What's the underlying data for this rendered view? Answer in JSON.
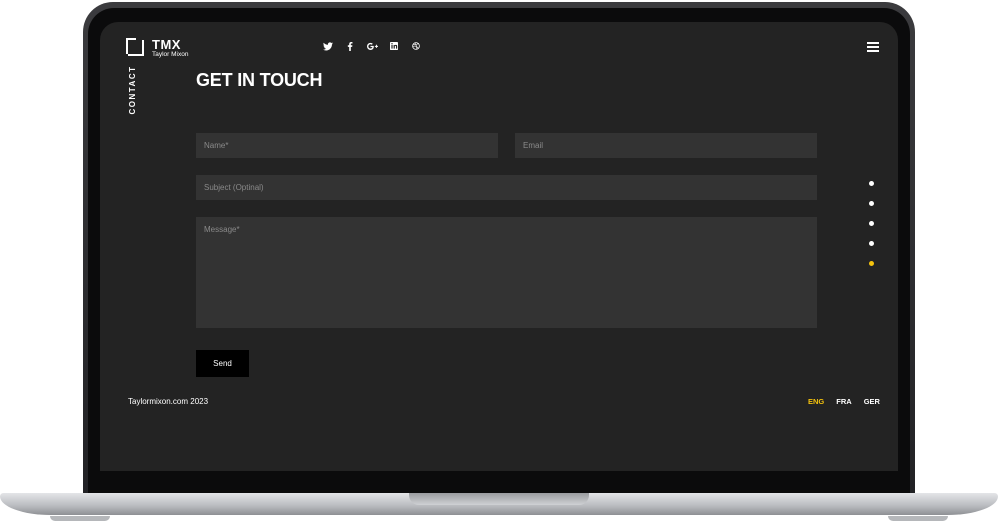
{
  "brand": {
    "name": "TMX",
    "owner": "Taylor Mixon"
  },
  "social_icons": [
    "twitter-icon",
    "facebook-icon",
    "google-plus-icon",
    "linkedin-icon",
    "dribbble-icon"
  ],
  "side_label": "CONTACT",
  "page_title": "GET IN TOUCH",
  "form": {
    "name_placeholder": "Name*",
    "email_placeholder": "Email",
    "subject_placeholder": "Subject (Optinal)",
    "message_placeholder": "Message*",
    "send_label": "Send"
  },
  "footer": {
    "copyright": "Taylormixon.com 2023"
  },
  "languages": [
    {
      "label": "ENG",
      "active": true
    },
    {
      "label": "FRA",
      "active": false
    },
    {
      "label": "GER",
      "active": false
    }
  ],
  "section_dots": {
    "count": 5,
    "active_index": 4
  },
  "colors": {
    "background": "#232323",
    "field": "#333333",
    "accent": "#f4c20d",
    "button": "#000000",
    "text": "#ffffff"
  }
}
